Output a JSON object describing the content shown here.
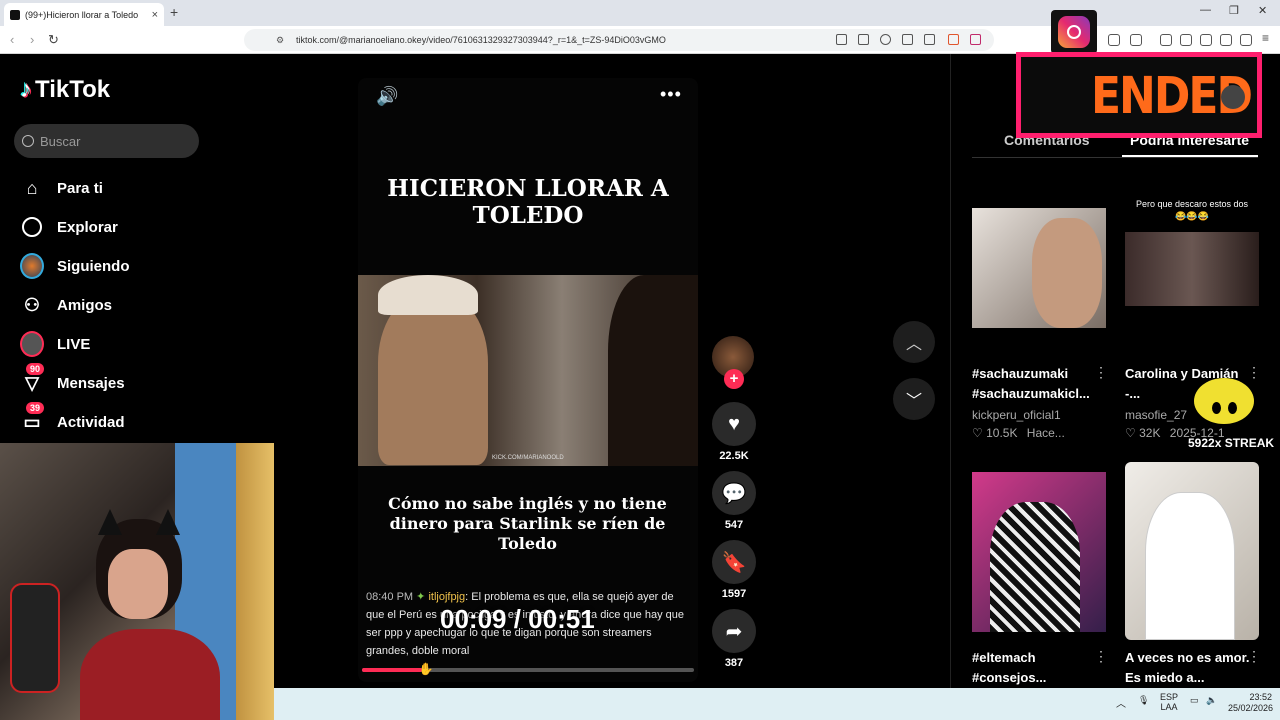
{
  "browser": {
    "tab_title": "(99+)Hicieron llorar a Toledo",
    "tab_close": "×",
    "new_tab": "+",
    "url": "tiktok.com/@marianoeliano.okey/video/7610631329327303944?_r=1&_t=ZS-94DiO03vGMO"
  },
  "sidebar": {
    "logo": "TikTok",
    "search_placeholder": "Buscar",
    "items": [
      {
        "label": "Para ti",
        "icon": "home-icon"
      },
      {
        "label": "Explorar",
        "icon": "compass-icon"
      },
      {
        "label": "Siguiendo",
        "icon": "following-avatar-icon"
      },
      {
        "label": "Amigos",
        "icon": "friends-icon"
      },
      {
        "label": "LIVE",
        "icon": "live-avatar-icon"
      },
      {
        "label": "Mensajes",
        "icon": "messages-icon",
        "badge": "90"
      },
      {
        "label": "Actividad",
        "icon": "activity-icon",
        "badge": "39"
      }
    ]
  },
  "video": {
    "headline": "HICIERON LLORAR A TOLEDO",
    "subtitle": "Cómo no sabe inglés y no tiene dinero para Starlink se ríen de Toledo",
    "watermark": "KICK.COM/MARIANOOLD",
    "timer": "00:09 / 00:51",
    "progress": 0.18
  },
  "chat": {
    "time": "08:40 PM",
    "user": "itljojfpjg",
    "message": ": El problema es que, ella se quejó ayer de que el Perú es una pocilga y es injusto, y ahora dice que hay que ser ppp y apechugar lo que te digan porque son streamers grandes, doble moral"
  },
  "actions": {
    "likes": "22.5K",
    "comments": "547",
    "saves": "1597",
    "shares": "387"
  },
  "right_panel": {
    "tab_comments": "Comentarios",
    "tab_suggested": "Podría interesarte",
    "cards": [
      {
        "title": "#sachauzumaki #sachauzumakicl...",
        "user": "kickperu_oficial1",
        "likes": "10.5K",
        "time": "Hace..."
      },
      {
        "title": "Carolina y Damián -...",
        "user": "masofie_27",
        "likes": "32K",
        "time": "2025-12-1",
        "overlay_text": "Pero que descaro estos dos 😂😂😂"
      },
      {
        "title": "#eltemach #consejos...",
        "user": "",
        "likes": "",
        "time": ""
      },
      {
        "title": "A veces no es amor. Es miedo a...",
        "user": "",
        "likes": "",
        "time": ""
      }
    ]
  },
  "overlays": {
    "ended": "ENDED",
    "streak": "5922x STREAK"
  },
  "taskbar": {
    "lang": "ESP",
    "lang2": "LAA",
    "time": "23:52",
    "date": "25/02/2026"
  },
  "colors": {
    "accent": "#fe2c55",
    "ended_text": "#ff6a1a",
    "ended_border": "#ff1f6e"
  }
}
